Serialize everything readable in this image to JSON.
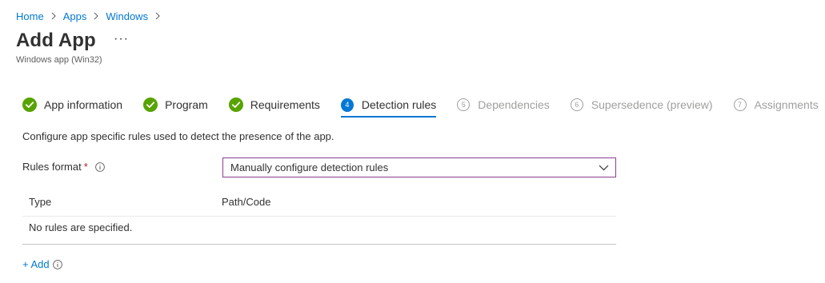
{
  "breadcrumb": [
    "Home",
    "Apps",
    "Windows"
  ],
  "header": {
    "title": "Add App",
    "more": "···",
    "subtitle": "Windows app (Win32)"
  },
  "steps": [
    {
      "label": "App information",
      "state": "done",
      "number": "1"
    },
    {
      "label": "Program",
      "state": "done",
      "number": "2"
    },
    {
      "label": "Requirements",
      "state": "done",
      "number": "3"
    },
    {
      "label": "Detection rules",
      "state": "current",
      "number": "4"
    },
    {
      "label": "Dependencies",
      "state": "todo",
      "number": "5"
    },
    {
      "label": "Supersedence (preview)",
      "state": "todo",
      "number": "6"
    },
    {
      "label": "Assignments",
      "state": "todo",
      "number": "7"
    }
  ],
  "main": {
    "description": "Configure app specific rules used to detect the presence of the app.",
    "rules_format": {
      "label": "Rules format",
      "required_marker": "*",
      "selected": "Manually configure detection rules"
    },
    "table": {
      "columns": [
        "Type",
        "Path/Code"
      ],
      "empty_text": "No rules are specified."
    },
    "add_label": "+ Add"
  },
  "colors": {
    "accent": "#0078d4",
    "success": "#57a300",
    "dropdown_border": "#8a3f8f",
    "required": "#a4262c"
  }
}
